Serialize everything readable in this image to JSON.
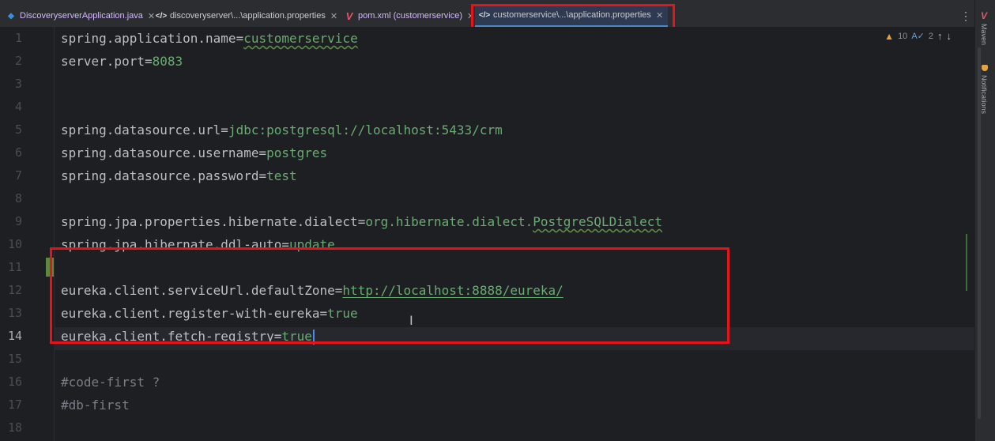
{
  "tabs": [
    {
      "label": "DiscoveryserverApplication.java",
      "icon": "java-class-icon"
    },
    {
      "label": "discoveryserver\\...\\application.properties",
      "icon": "properties-file-icon"
    },
    {
      "label": "pom.xml (customerservice)",
      "icon": "maven-icon"
    },
    {
      "label": "customerservice\\...\\application.properties",
      "icon": "properties-file-icon",
      "active": true
    }
  ],
  "inspections": {
    "warnings": "10",
    "typos": "2"
  },
  "right_strip": {
    "maven": "Maven",
    "notifications": "Notifications"
  },
  "editor": {
    "current_line": "14",
    "lines": [
      {
        "no": "1",
        "key": "spring.application.name",
        "value": "customerservice"
      },
      {
        "no": "2",
        "key": "server.port",
        "value": "8083"
      },
      {
        "no": "3"
      },
      {
        "no": "4"
      },
      {
        "no": "5",
        "key": "spring.datasource.url",
        "value": "jdbc:postgresql://localhost:5433/crm"
      },
      {
        "no": "6",
        "key": "spring.datasource.username",
        "value": "postgres"
      },
      {
        "no": "7",
        "key": "spring.datasource.password",
        "value": "test"
      },
      {
        "no": "8"
      },
      {
        "no": "9",
        "key": "spring.jpa.properties.hibernate.dialect",
        "value": "org.hibernate.dialect.",
        "value2": "PostgreSQLDialect"
      },
      {
        "no": "10",
        "key": "spring.jpa.hibernate.ddl-auto",
        "value": "update"
      },
      {
        "no": "11"
      },
      {
        "no": "12",
        "key": "eureka.client.serviceUrl.defaultZone",
        "value": "http://localhost:8888/eureka/"
      },
      {
        "no": "13",
        "key": "eureka.client.register-with-eureka",
        "value": "true"
      },
      {
        "no": "14",
        "key": "eureka.client.fetch-registry",
        "value": "true"
      },
      {
        "no": "15"
      },
      {
        "no": "16",
        "comment": "#code-first ?"
      },
      {
        "no": "17",
        "comment": "#db-first"
      },
      {
        "no": "18"
      }
    ]
  },
  "colors": {
    "annotation": "#e8121b",
    "value": "#6aab73",
    "key": "#bcbec4",
    "background": "#1e1f22"
  }
}
